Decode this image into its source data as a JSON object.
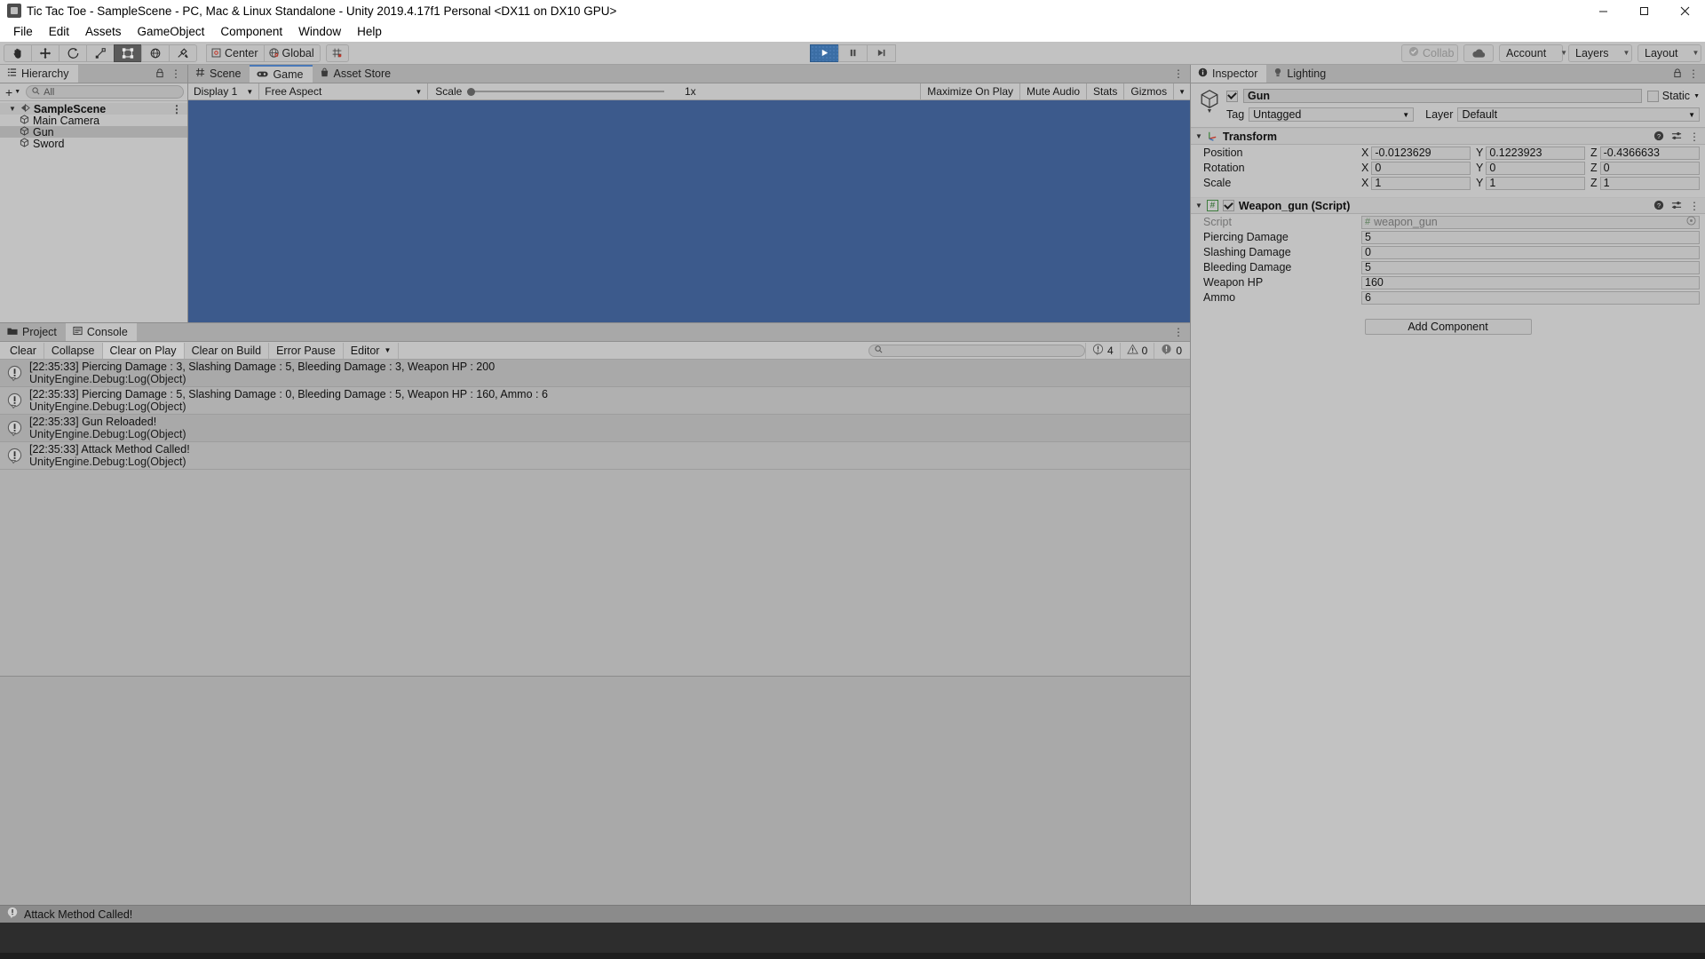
{
  "window": {
    "title": "Tic Tac Toe - SampleScene - PC, Mac & Linux Standalone - Unity 2019.4.17f1 Personal <DX11 on DX10 GPU>",
    "icon": "unity-icon",
    "controls": {
      "minimize": "minimize-icon",
      "maximize": "maximize-icon",
      "close": "close-icon"
    }
  },
  "menubar": {
    "items": [
      "File",
      "Edit",
      "Assets",
      "GameObject",
      "Component",
      "Window",
      "Help"
    ]
  },
  "toolbar": {
    "tools": [
      {
        "name": "hand-tool",
        "active": false
      },
      {
        "name": "move-tool",
        "active": false
      },
      {
        "name": "rotate-tool",
        "active": false
      },
      {
        "name": "scale-tool",
        "active": false
      },
      {
        "name": "rect-tool",
        "active": true
      },
      {
        "name": "transform-tool",
        "active": false
      },
      {
        "name": "custom-tool",
        "active": false
      }
    ],
    "pivot_label": "Center",
    "handle_label": "Global",
    "grid_label": "grid-snap-icon",
    "play": "play-button",
    "pause": "pause-button",
    "step": "step-button",
    "play_active": true,
    "collab_label": "Collab",
    "cloud_label": "cloud-icon",
    "account_label": "Account",
    "layers_label": "Layers",
    "layout_label": "Layout"
  },
  "hierarchy": {
    "tab_label": "Hierarchy",
    "tab_icon": "hierarchy-icon",
    "add_label": "+",
    "search_placeholder": "All",
    "scene": {
      "label": "SampleScene",
      "expanded": true
    },
    "objects": [
      {
        "label": "Main Camera",
        "selected": false
      },
      {
        "label": "Gun",
        "selected": true
      },
      {
        "label": "Sword",
        "selected": false
      }
    ]
  },
  "sceneview": {
    "tabs": [
      {
        "label": "Scene",
        "icon": "scene-grid-icon",
        "active": false
      },
      {
        "label": "Game",
        "icon": "gamepad-icon",
        "active": true
      },
      {
        "label": "Asset Store",
        "icon": "store-bag-icon",
        "active": false
      }
    ],
    "display": "Display 1",
    "aspect": "Free Aspect",
    "scale_label": "Scale",
    "scale_value": "1x",
    "maximize_on_play": "Maximize On Play",
    "mute_audio": "Mute Audio",
    "stats": "Stats",
    "gizmos": "Gizmos",
    "canvas_color": "#3c5a8c"
  },
  "console": {
    "tabs": [
      {
        "label": "Project",
        "icon": "folder-icon",
        "active": false
      },
      {
        "label": "Console",
        "icon": "console-icon",
        "active": true
      }
    ],
    "buttons": [
      {
        "label": "Clear",
        "pressed": false
      },
      {
        "label": "Collapse",
        "pressed": false
      },
      {
        "label": "Clear on Play",
        "pressed": true
      },
      {
        "label": "Clear on Build",
        "pressed": false
      },
      {
        "label": "Error Pause",
        "pressed": false
      }
    ],
    "editor_dropdown": "Editor",
    "search_placeholder": "",
    "counts": {
      "log": "4",
      "warning": "0",
      "error": "0"
    },
    "entries": [
      {
        "message": "[22:35:33] Piercing Damage : 3, Slashing Damage : 5, Bleeding Damage : 3, Weapon HP : 200",
        "source": "UnityEngine.Debug:Log(Object)",
        "icon": "log-icon"
      },
      {
        "message": "[22:35:33] Piercing Damage : 5, Slashing Damage : 0, Bleeding Damage : 5, Weapon HP : 160, Ammo : 6",
        "source": "UnityEngine.Debug:Log(Object)",
        "icon": "log-icon"
      },
      {
        "message": "[22:35:33] Gun Reloaded!",
        "source": "UnityEngine.Debug:Log(Object)",
        "icon": "log-icon"
      },
      {
        "message": "[22:35:33] Attack Method Called!",
        "source": "UnityEngine.Debug:Log(Object)",
        "icon": "log-icon"
      }
    ]
  },
  "inspector": {
    "tabs": [
      {
        "label": "Inspector",
        "icon": "info-icon",
        "active": true
      },
      {
        "label": "Lighting",
        "icon": "bulb-icon",
        "active": false
      }
    ],
    "object_name": "Gun",
    "enabled": true,
    "static_label": "Static",
    "tag_label": "Tag",
    "tag_value": "Untagged",
    "layer_label": "Layer",
    "layer_value": "Default",
    "transform": {
      "title": "Transform",
      "rows": [
        {
          "label": "Position",
          "x": "-0.0123629",
          "y": "0.1223923",
          "z": "-0.4366633"
        },
        {
          "label": "Rotation",
          "x": "0",
          "y": "0",
          "z": "0"
        },
        {
          "label": "Scale",
          "x": "1",
          "y": "1",
          "z": "1"
        }
      ]
    },
    "script_component": {
      "title": "Weapon_gun (Script)",
      "enabled": true,
      "script_label": "Script",
      "script_value": "weapon_gun",
      "fields": [
        {
          "label": "Piercing Damage",
          "value": "5"
        },
        {
          "label": "Slashing Damage",
          "value": "0"
        },
        {
          "label": "Bleeding Damage",
          "value": "5"
        },
        {
          "label": "Weapon HP",
          "value": "160"
        },
        {
          "label": "Ammo",
          "value": "6"
        }
      ]
    },
    "add_component_label": "Add Component"
  },
  "statusbar": {
    "message": "Attack Method Called!",
    "icon": "log-icon"
  }
}
